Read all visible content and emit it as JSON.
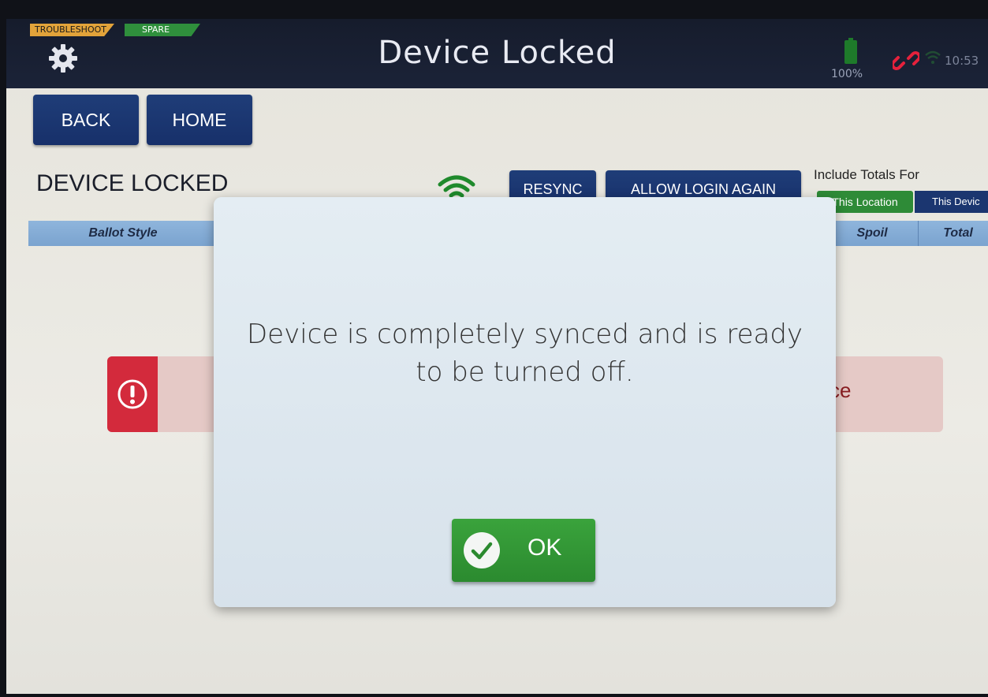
{
  "topbar": {
    "badge_troubleshoot": "TROUBLESHOOT",
    "badge_spare": "SPARE",
    "title": "Device Locked",
    "battery": "100%",
    "time": "10:53"
  },
  "nav": {
    "back_label": "BACK",
    "home_label": "HOME"
  },
  "content": {
    "heading": "DEVICE LOCKED",
    "resync_label": "RESYNC",
    "allow_login_label": "ALLOW LOGIN AGAIN",
    "include_totals_label": "Include Totals For",
    "toggle_options": [
      "This Location",
      "This Devic"
    ],
    "table_headers": {
      "ballot_style": "Ballot Style",
      "spoil": "Spoil",
      "total": "Total"
    },
    "alert_text_fragment": "ce"
  },
  "modal": {
    "message": "Device is completely synced and is ready to be turned off.",
    "ok_label": "OK"
  },
  "colors": {
    "topbar": "#161c2c",
    "nav_button": "#1f3d78",
    "ok_button": "#3aa33c",
    "alert_icon_bg": "#d32a3c",
    "toggle_active": "#2e8b37"
  },
  "icons": {
    "settings": "gear-icon",
    "battery": "battery-icon",
    "link_broken": "broken-link-icon",
    "wifi": "wifi-icon",
    "alert": "exclamation-icon",
    "ok": "checkmark-icon"
  }
}
